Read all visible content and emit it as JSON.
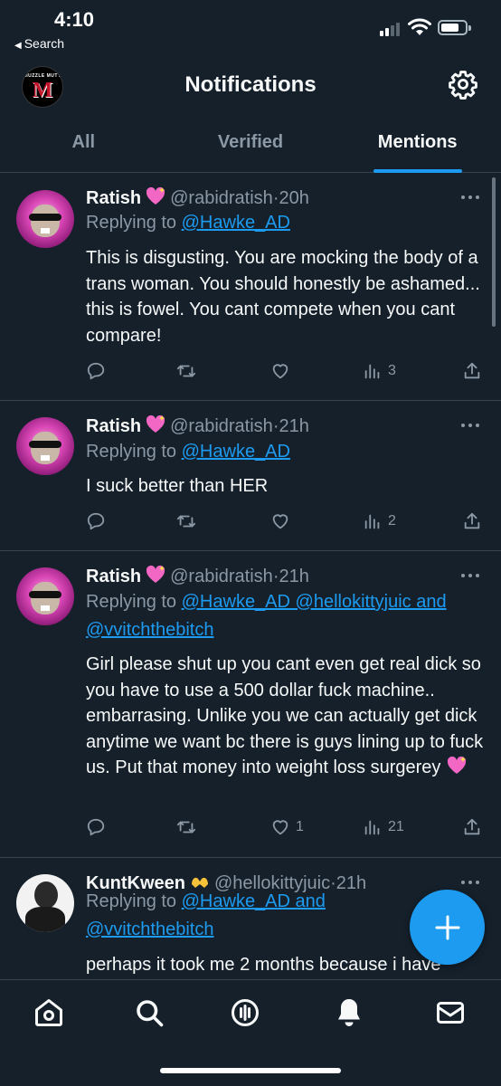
{
  "status_bar": {
    "time": "4:10",
    "back_label": "Search"
  },
  "header": {
    "title": "Notifications",
    "logo_text_top": "MUZZLE MUTT",
    "logo_text_main": "M"
  },
  "tabs": [
    {
      "label": "All",
      "active": false
    },
    {
      "label": "Verified",
      "active": false
    },
    {
      "label": "Mentions",
      "active": true
    }
  ],
  "tweets": [
    {
      "name": "Ratish",
      "emoji": "sparkling-heart",
      "handle": "@rabidratish",
      "sep": "·",
      "time": "20h",
      "replying_prefix": "Replying to ",
      "mentions": "@Hawke_AD",
      "text": "This is disgusting. You are mocking the body of a trans woman. You should honestly be ashamed... this is fowel. You cant compete when you cant compare!",
      "likes": "",
      "views": "3"
    },
    {
      "name": "Ratish",
      "emoji": "sparkling-heart",
      "handle": "@rabidratish",
      "sep": "·",
      "time": "21h",
      "replying_prefix": "Replying to ",
      "mentions": "@Hawke_AD",
      "text": "I suck better than HER",
      "likes": "",
      "views": "2"
    },
    {
      "name": "Ratish",
      "emoji": "sparkling-heart",
      "handle": "@rabidratish",
      "sep": "·",
      "time": "21h",
      "replying_prefix": "Replying to ",
      "mentions": "@Hawke_AD @hellokittyjuic and @vvitchthebitch",
      "text": "Girl please shut up you cant even get real dick so you have to use a 500 dollar fuck machine.. embarrasing. Unlike you we can actually get dick anytime we want bc there is guys lining up to fuck us. Put that money into weight loss surgerey",
      "likes": "1",
      "views": "21"
    },
    {
      "name": "KuntKween",
      "emoji": "heart-hands",
      "handle": "@hellokittyjuic",
      "sep": "·",
      "time": "21h",
      "replying_prefix": "Replying to ",
      "mentions": "@Hawke_AD and @vvitchthebitch",
      "text": "perhaps it took me 2 months because i have"
    }
  ],
  "colors": {
    "background": "#15202b",
    "accent": "#1d9bf0",
    "muted": "#8b98a5",
    "divider": "#38444d"
  },
  "bottom_nav": [
    "home-icon",
    "search-icon",
    "spaces-icon",
    "notifications-icon",
    "messages-icon"
  ]
}
